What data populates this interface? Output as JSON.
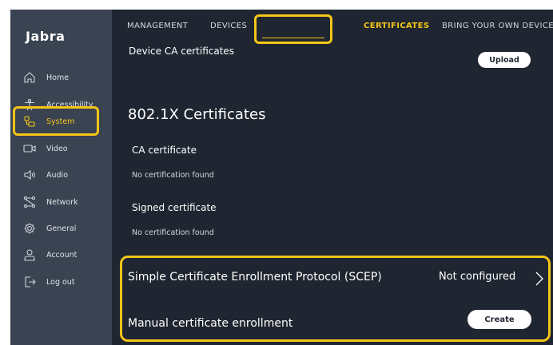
{
  "app": {
    "brand": "Jabra"
  },
  "sidebar": {
    "items": [
      {
        "label": "Home",
        "icon": "home-icon"
      },
      {
        "label": "Accessibility",
        "icon": "accessibility-icon"
      },
      {
        "label": "System",
        "icon": "system-icon",
        "active": true
      },
      {
        "label": "Video",
        "icon": "video-icon"
      },
      {
        "label": "Audio",
        "icon": "audio-icon"
      },
      {
        "label": "Network",
        "icon": "network-icon"
      },
      {
        "label": "General",
        "icon": "gear-icon"
      },
      {
        "label": "Account",
        "icon": "account-icon"
      },
      {
        "label": "Log out",
        "icon": "logout-icon"
      }
    ]
  },
  "tabs": [
    {
      "label": "MANAGEMENT"
    },
    {
      "label": "DEVICES"
    },
    {
      "label": "CERTIFICATES",
      "active": true
    },
    {
      "label": "BRING YOUR OWN DEVICE"
    }
  ],
  "device_ca": {
    "label": "Device CA certificates",
    "upload_label": "Upload"
  },
  "section": {
    "title": "802.1X Certificates"
  },
  "ca_certificate": {
    "label": "CA certificate",
    "value": "No certification found"
  },
  "signed_certificate": {
    "label": "Signed certificate",
    "value": "No certification found"
  },
  "scep": {
    "title": "Simple Certificate Enrollment Protocol (SCEP)",
    "status": "Not configured"
  },
  "manual": {
    "title": "Manual certificate enrollment",
    "create_label": "Create"
  },
  "colors": {
    "accent": "#f5c518",
    "sidebar": "#3a4351",
    "main": "#1f2631"
  }
}
